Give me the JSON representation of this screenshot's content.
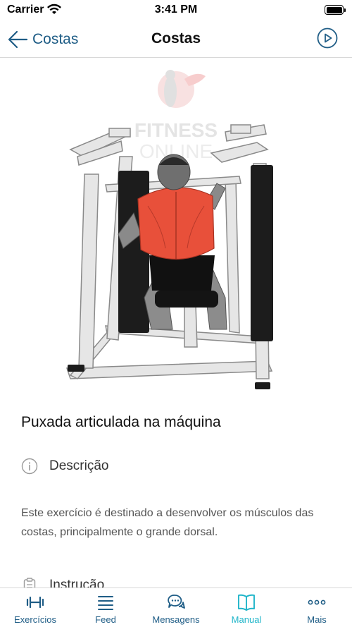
{
  "status_bar": {
    "carrier": "Carrier",
    "time": "3:41 PM"
  },
  "nav": {
    "back_label": "Costas",
    "title": "Costas"
  },
  "hero": {
    "watermark_line1": "FITNESS",
    "watermark_line2": "ONLINE",
    "highlight_color": "#e8503a"
  },
  "exercise": {
    "title": "Puxada articulada na máquina",
    "description_label": "Descrição",
    "description_text": "Este exercício é destinado a desenvolver os músculos das costas, principalmente o grande dorsal.",
    "instruction_label": "Instrução"
  },
  "tabs": [
    {
      "label": "Exercícios",
      "icon": "dumbbell-icon",
      "active": false
    },
    {
      "label": "Feed",
      "icon": "feed-lines-icon",
      "active": false
    },
    {
      "label": "Mensagens",
      "icon": "chat-bubbles-icon",
      "active": false
    },
    {
      "label": "Manual",
      "icon": "book-icon",
      "active": true
    },
    {
      "label": "Mais",
      "icon": "more-dots-icon",
      "active": false
    }
  ],
  "colors": {
    "accent": "#1f5d86",
    "active_tab": "#1fb5c9"
  }
}
